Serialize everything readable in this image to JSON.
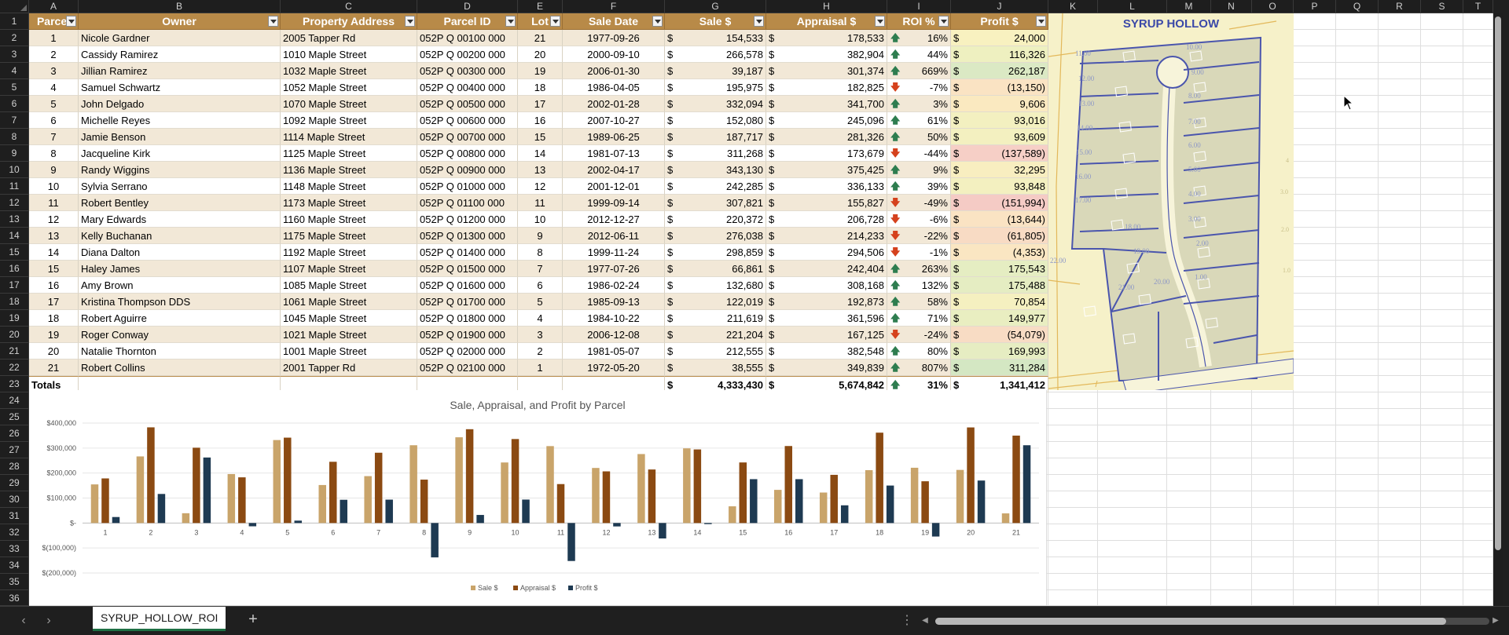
{
  "columns": [
    "A",
    "B",
    "C",
    "D",
    "E",
    "F",
    "G",
    "H",
    "I",
    "J",
    "K",
    "L",
    "M",
    "N",
    "O",
    "P",
    "Q",
    "R",
    "S",
    "T"
  ],
  "headers": [
    "Parcel",
    "Owner",
    "Property Address",
    "Parcel ID",
    "Lot",
    "Sale Date",
    "Sale $",
    "Appraisal $",
    "ROI %",
    "Profit $"
  ],
  "currency_symbol": "$",
  "rows": [
    {
      "parcel": "1",
      "owner": "Nicole Gardner",
      "address": "2005 Tapper Rd",
      "pid": "052P Q 00100 000",
      "lot": "21",
      "date": "1977-09-26",
      "sale": "154,533",
      "appraisal": "178,533",
      "roi": "16%",
      "profit": "24,000",
      "dir": "up",
      "tint": "#f8f1c0"
    },
    {
      "parcel": "2",
      "owner": "Cassidy Ramirez",
      "address": "1010 Maple Street",
      "pid": "052P Q 00200 000",
      "lot": "20",
      "date": "2000-09-10",
      "sale": "266,578",
      "appraisal": "382,904",
      "roi": "44%",
      "profit": "116,326",
      "dir": "up",
      "tint": "#eef0c0"
    },
    {
      "parcel": "3",
      "owner": "Jillian Ramirez",
      "address": "1032 Maple Street",
      "pid": "052P Q 00300 000",
      "lot": "19",
      "date": "2006-01-30",
      "sale": "39,187",
      "appraisal": "301,374",
      "roi": "669%",
      "profit": "262,187",
      "dir": "up",
      "tint": "#dbe9c4"
    },
    {
      "parcel": "4",
      "owner": "Samuel Schwartz",
      "address": "1052 Maple Street",
      "pid": "052P Q 00400 000",
      "lot": "18",
      "date": "1986-04-05",
      "sale": "195,975",
      "appraisal": "182,825",
      "roi": "-7%",
      "profit": "(13,150)",
      "dir": "down",
      "tint": "#fae3c3"
    },
    {
      "parcel": "5",
      "owner": "John Delgado",
      "address": "1070 Maple Street",
      "pid": "052P Q 00500 000",
      "lot": "17",
      "date": "2002-01-28",
      "sale": "332,094",
      "appraisal": "341,700",
      "roi": "3%",
      "profit": "9,606",
      "dir": "up",
      "tint": "#fae9c0"
    },
    {
      "parcel": "6",
      "owner": "Michelle Reyes",
      "address": "1092 Maple Street",
      "pid": "052P Q 00600 000",
      "lot": "16",
      "date": "2007-10-27",
      "sale": "152,080",
      "appraisal": "245,096",
      "roi": "61%",
      "profit": "93,016",
      "dir": "up",
      "tint": "#f3f0c0"
    },
    {
      "parcel": "7",
      "owner": "Jamie Benson",
      "address": "1114 Maple Street",
      "pid": "052P Q 00700 000",
      "lot": "15",
      "date": "1989-06-25",
      "sale": "187,717",
      "appraisal": "281,326",
      "roi": "50%",
      "profit": "93,609",
      "dir": "up",
      "tint": "#f3f0c0"
    },
    {
      "parcel": "8",
      "owner": "Jacqueline Kirk",
      "address": "1125 Maple Street",
      "pid": "052P Q 00800 000",
      "lot": "14",
      "date": "1981-07-13",
      "sale": "311,268",
      "appraisal": "173,679",
      "roi": "-44%",
      "profit": "(137,589)",
      "dir": "down",
      "tint": "#f6cfc6"
    },
    {
      "parcel": "9",
      "owner": "Randy Wiggins",
      "address": "1136 Maple Street",
      "pid": "052P Q 00900 000",
      "lot": "13",
      "date": "2002-04-17",
      "sale": "343,130",
      "appraisal": "375,425",
      "roi": "9%",
      "profit": "32,295",
      "dir": "up",
      "tint": "#f8eec0"
    },
    {
      "parcel": "10",
      "owner": "Sylvia Serrano",
      "address": "1148 Maple Street",
      "pid": "052P Q 01000 000",
      "lot": "12",
      "date": "2001-12-01",
      "sale": "242,285",
      "appraisal": "336,133",
      "roi": "39%",
      "profit": "93,848",
      "dir": "up",
      "tint": "#f3f0c0"
    },
    {
      "parcel": "11",
      "owner": "Robert Bentley",
      "address": "1173 Maple Street",
      "pid": "052P Q 01100 000",
      "lot": "11",
      "date": "1999-09-14",
      "sale": "307,821",
      "appraisal": "155,827",
      "roi": "-49%",
      "profit": "(151,994)",
      "dir": "down",
      "tint": "#f5cbc5"
    },
    {
      "parcel": "12",
      "owner": "Mary Edwards",
      "address": "1160 Maple Street",
      "pid": "052P Q 01200 000",
      "lot": "10",
      "date": "2012-12-27",
      "sale": "220,372",
      "appraisal": "206,728",
      "roi": "-6%",
      "profit": "(13,644)",
      "dir": "down",
      "tint": "#fae3c3"
    },
    {
      "parcel": "13",
      "owner": "Kelly Buchanan",
      "address": "1175 Maple Street",
      "pid": "052P Q 01300 000",
      "lot": "9",
      "date": "2012-06-11",
      "sale": "276,038",
      "appraisal": "214,233",
      "roi": "-22%",
      "profit": "(61,805)",
      "dir": "down",
      "tint": "#f8dbc4"
    },
    {
      "parcel": "14",
      "owner": "Diana Dalton",
      "address": "1192 Maple Street",
      "pid": "052P Q 01400 000",
      "lot": "8",
      "date": "1999-11-24",
      "sale": "298,859",
      "appraisal": "294,506",
      "roi": "-1%",
      "profit": "(4,353)",
      "dir": "down",
      "tint": "#fae6c2"
    },
    {
      "parcel": "15",
      "owner": "Haley James",
      "address": "1107 Maple Street",
      "pid": "052P Q 01500 000",
      "lot": "7",
      "date": "1977-07-26",
      "sale": "66,861",
      "appraisal": "242,404",
      "roi": "263%",
      "profit": "175,543",
      "dir": "up",
      "tint": "#e5edc2"
    },
    {
      "parcel": "16",
      "owner": "Amy Brown",
      "address": "1085 Maple Street",
      "pid": "052P Q 01600 000",
      "lot": "6",
      "date": "1986-02-24",
      "sale": "132,680",
      "appraisal": "308,168",
      "roi": "132%",
      "profit": "175,488",
      "dir": "up",
      "tint": "#e5edc2"
    },
    {
      "parcel": "17",
      "owner": "Kristina Thompson DDS",
      "address": "1061 Maple Street",
      "pid": "052P Q 01700 000",
      "lot": "5",
      "date": "1985-09-13",
      "sale": "122,019",
      "appraisal": "192,873",
      "roi": "58%",
      "profit": "70,854",
      "dir": "up",
      "tint": "#f5f0c0"
    },
    {
      "parcel": "18",
      "owner": "Robert Aguirre",
      "address": "1045 Maple Street",
      "pid": "052P Q 01800 000",
      "lot": "4",
      "date": "1984-10-22",
      "sale": "211,619",
      "appraisal": "361,596",
      "roi": "71%",
      "profit": "149,977",
      "dir": "up",
      "tint": "#e9eec1"
    },
    {
      "parcel": "19",
      "owner": "Roger Conway",
      "address": "1021 Maple Street",
      "pid": "052P Q 01900 000",
      "lot": "3",
      "date": "2006-12-08",
      "sale": "221,204",
      "appraisal": "167,125",
      "roi": "-24%",
      "profit": "(54,079)",
      "dir": "down",
      "tint": "#f8dcc4"
    },
    {
      "parcel": "20",
      "owner": "Natalie Thornton",
      "address": "1001 Maple Street",
      "pid": "052P Q 02000 000",
      "lot": "2",
      "date": "1981-05-07",
      "sale": "212,555",
      "appraisal": "382,548",
      "roi": "80%",
      "profit": "169,993",
      "dir": "up",
      "tint": "#e6edc2"
    },
    {
      "parcel": "21",
      "owner": "Robert Collins",
      "address": "2001 Tapper Rd",
      "pid": "052P Q 02100 000",
      "lot": "1",
      "date": "1972-05-20",
      "sale": "38,555",
      "appraisal": "349,839",
      "roi": "807%",
      "profit": "311,284",
      "dir": "up",
      "tint": "#d4e7c3"
    }
  ],
  "totals": {
    "label": "Totals",
    "sale": "4,333,430",
    "appraisal": "5,674,842",
    "roi": "31%",
    "profit": "1,341,412",
    "dir": "up"
  },
  "colors": {
    "header_gold": "#b88a48",
    "band": "#f2e8d7",
    "sale": "#c9a46a",
    "appraisal": "#8b4a12",
    "profit": "#1e3a52",
    "up": "#2e7d4f",
    "down": "#d5411c",
    "tab_underline": "#1e7145"
  },
  "icons": {
    "up": "arrow-up-icon",
    "down": "arrow-down-icon",
    "cursor": "mouse-pointer-icon"
  },
  "chart_data": {
    "type": "bar",
    "title": "Sale, Appraisal, and Profit by Parcel",
    "categories": [
      "1",
      "2",
      "3",
      "4",
      "5",
      "6",
      "7",
      "8",
      "9",
      "10",
      "11",
      "12",
      "13",
      "14",
      "15",
      "16",
      "17",
      "18",
      "19",
      "20",
      "21"
    ],
    "series": [
      {
        "name": "Sale $",
        "values": [
          154533,
          266578,
          39187,
          195975,
          332094,
          152080,
          187717,
          311268,
          343130,
          242285,
          307821,
          220372,
          276038,
          298859,
          66861,
          132680,
          122019,
          211619,
          221204,
          212555,
          38555
        ]
      },
      {
        "name": "Appraisal $",
        "values": [
          178533,
          382904,
          301374,
          182825,
          341700,
          245096,
          281326,
          173679,
          375425,
          336133,
          155827,
          206728,
          214233,
          294506,
          242404,
          308168,
          192873,
          361596,
          167125,
          382548,
          349839
        ]
      },
      {
        "name": "Profit $",
        "values": [
          24000,
          116326,
          262187,
          -13150,
          9606,
          93016,
          93609,
          -137589,
          32295,
          93848,
          -151994,
          -13644,
          -61805,
          -4353,
          175543,
          175488,
          70854,
          149977,
          -54079,
          169993,
          311284
        ]
      }
    ],
    "y_ticks": [
      "$400,000",
      "$300,000",
      "$200,000",
      "$100,000",
      "$-",
      "$(100,000)",
      "$(200,000)"
    ],
    "ylim": [
      -200000,
      400000
    ],
    "legend_position": "bottom",
    "grid": true
  },
  "map": {
    "title": "SYRUP HOLLOW",
    "lots_left": [
      "11.00",
      "12.00",
      "13.00",
      "14.00",
      "15.00",
      "16.00",
      "17.00",
      "18.00",
      "19.00",
      "20.00",
      "21.00",
      "22.00"
    ],
    "lots_right": [
      "10.00",
      "9.00",
      "8.00",
      "7.00",
      "6.00",
      "5.00",
      "4.00",
      "3.00",
      "2.00",
      "1.00"
    ],
    "margin_numbers": [
      "4",
      "3.0",
      "2.0",
      "1.0"
    ]
  },
  "tabs": {
    "sheet_name": "SYRUP_HOLLOW_ROI",
    "add_label": "+",
    "prev": "‹",
    "next": "›",
    "more": "⋮"
  }
}
